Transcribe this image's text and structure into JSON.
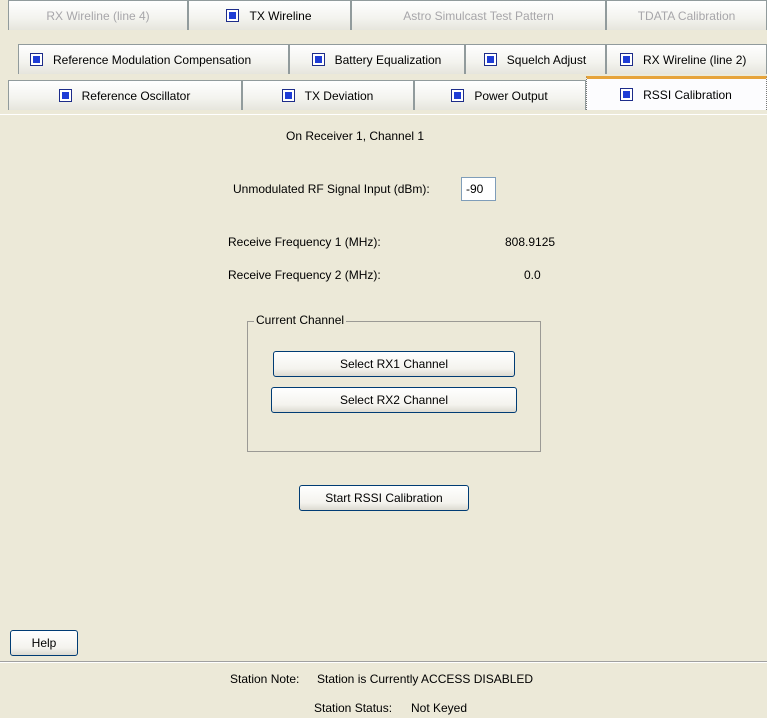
{
  "tabs": {
    "row1": [
      {
        "label": "RX Wireline (line 4)",
        "enabled": false
      },
      {
        "label": "TX Wireline",
        "enabled": true
      },
      {
        "label": "Astro Simulcast Test Pattern",
        "enabled": false
      },
      {
        "label": "TDATA Calibration",
        "enabled": false
      }
    ],
    "row2": [
      {
        "label": "Reference Modulation Compensation",
        "enabled": true
      },
      {
        "label": "Battery Equalization",
        "enabled": true
      },
      {
        "label": "Squelch Adjust",
        "enabled": true
      },
      {
        "label": "RX Wireline (line 2)",
        "enabled": true
      }
    ],
    "row3": [
      {
        "label": "Reference Oscillator",
        "enabled": true
      },
      {
        "label": "TX Deviation",
        "enabled": true
      },
      {
        "label": "Power Output",
        "enabled": true
      },
      {
        "label": "RSSI Calibration",
        "enabled": true,
        "active": true
      }
    ]
  },
  "main": {
    "receiver_heading": "On Receiver 1, Channel 1",
    "rf_input_label": "Unmodulated RF Signal Input (dBm):",
    "rf_input_value": "-90",
    "freq1_label": "Receive Frequency 1 (MHz):",
    "freq1_value": "808.9125",
    "freq2_label": "Receive Frequency 2 (MHz):",
    "freq2_value": "0.0",
    "group_title": "Current Channel",
    "select_rx1_label": "Select RX1 Channel",
    "select_rx2_label": "Select RX2 Channel",
    "start_label": "Start RSSI Calibration",
    "help_label": "Help"
  },
  "footer": {
    "note_label": "Station Note:",
    "note_value": "Station is Currently ACCESS DISABLED",
    "status_label": "Station Status:",
    "status_value": "Not Keyed"
  },
  "colors": {
    "background": "#ece9d8",
    "checkbox_fill": "#1f3dd6",
    "active_tab_accent": "#e6a33a"
  }
}
